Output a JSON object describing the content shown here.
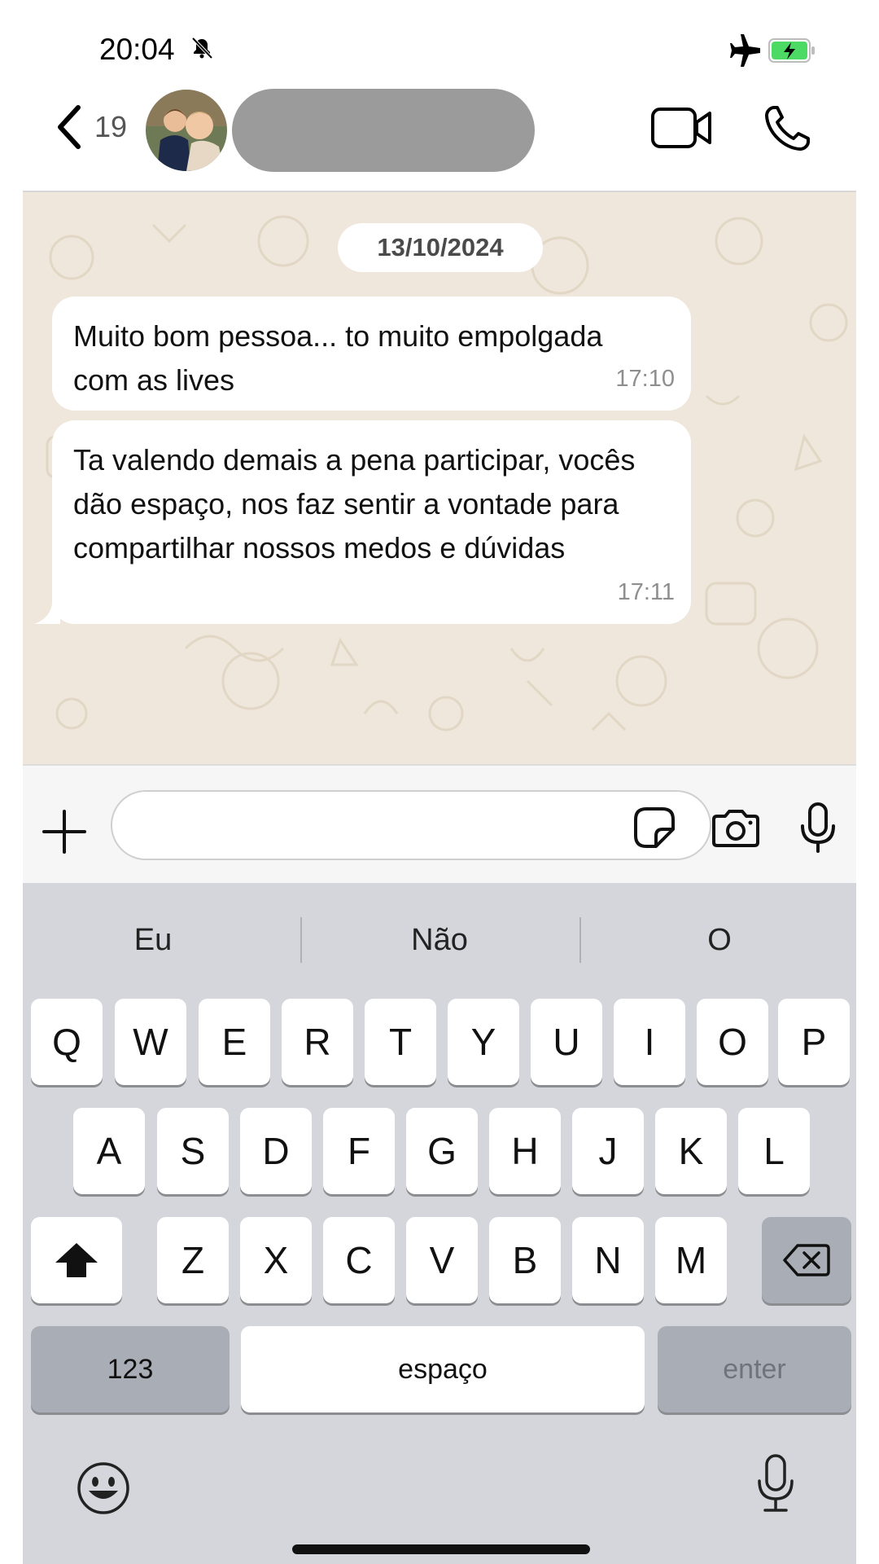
{
  "status_bar": {
    "time": "20:04",
    "icons": [
      "bell-muted-icon",
      "airplane-icon",
      "battery-charging-icon"
    ]
  },
  "header": {
    "back_count": "19",
    "icons": [
      "chevron-left-icon",
      "avatar",
      "video-camera-icon",
      "phone-icon"
    ]
  },
  "chat": {
    "date": "13/10/2024",
    "messages": [
      {
        "text": "Muito bom pessoa... to muito empolgada com as lives",
        "time": "17:10"
      },
      {
        "text": "Ta valendo demais a pena participar, vocês dão espaço, nos faz sentir a vontade para compartilhar nossos medos e dúvidas",
        "time": "17:11"
      }
    ]
  },
  "input_bar": {
    "value": "",
    "placeholder": "",
    "icons": [
      "plus-icon",
      "sticker-icon",
      "camera-icon",
      "microphone-icon"
    ]
  },
  "keyboard": {
    "suggestions": [
      "Eu",
      "Não",
      "O"
    ],
    "row1": [
      "Q",
      "W",
      "E",
      "R",
      "T",
      "Y",
      "U",
      "I",
      "O",
      "P"
    ],
    "row2": [
      "A",
      "S",
      "D",
      "F",
      "G",
      "H",
      "J",
      "K",
      "L"
    ],
    "row3": [
      "Z",
      "X",
      "C",
      "V",
      "B",
      "N",
      "M"
    ],
    "numbers_label": "123",
    "space_label": "espaço",
    "enter_label": "enter",
    "icons": [
      "shift-icon",
      "backspace-icon",
      "emoji-icon",
      "dictation-microphone-icon"
    ]
  },
  "colors": {
    "chat_background": "#efe7dc",
    "bubble": "#ffffff",
    "battery_fill": "#4cd964",
    "keyboard_background": "#d4d6db",
    "name_redaction": "#9b9b9b"
  }
}
